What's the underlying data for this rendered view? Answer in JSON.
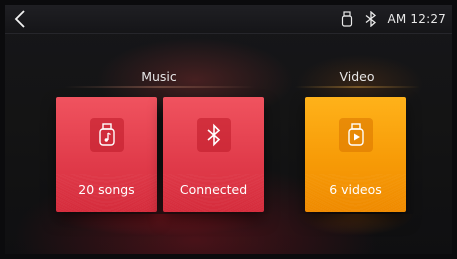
{
  "statusbar": {
    "back_icon": "chevron-left-icon",
    "usb_icon": "usb-drive-icon",
    "bluetooth_icon": "bluetooth-icon",
    "clock": "AM 12:27"
  },
  "sections": {
    "music": {
      "title": "Music"
    },
    "video": {
      "title": "Video"
    }
  },
  "cards": {
    "songs": {
      "label": "20 songs",
      "icon": "usb-music-icon",
      "color": "#e5414f"
    },
    "bluetooth": {
      "label": "Connected",
      "icon": "bluetooth-icon",
      "color": "#e5414f"
    },
    "videos": {
      "label": "6 videos",
      "icon": "usb-video-icon",
      "color": "#f99c0a"
    }
  }
}
